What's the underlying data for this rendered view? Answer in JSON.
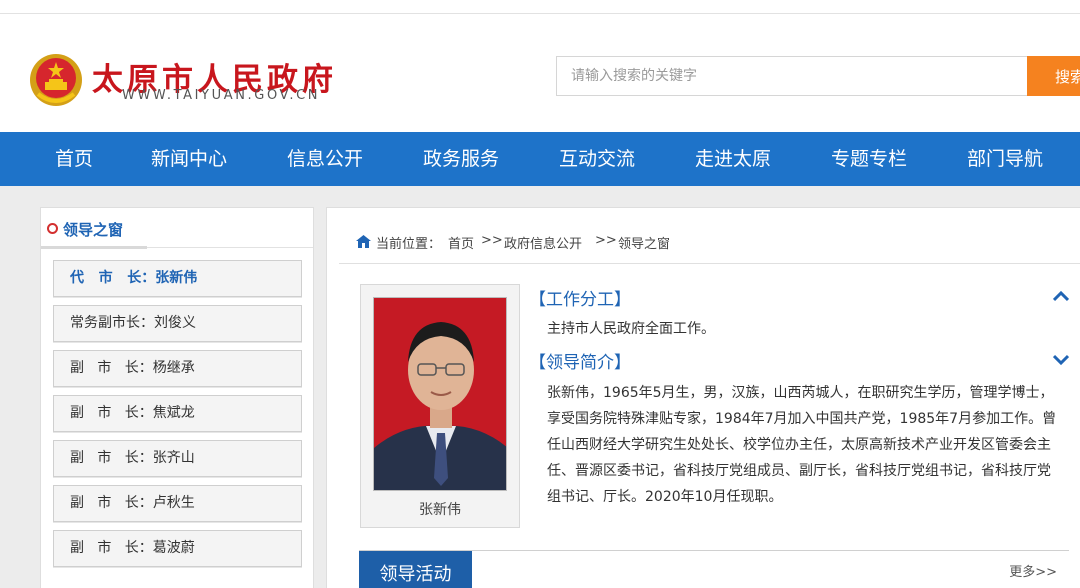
{
  "site": {
    "title": "太原市人民政府",
    "url": "WWW.TAIYUAN.GOV.CN"
  },
  "search": {
    "placeholder": "请输入搜索的关键字",
    "button": "搜索"
  },
  "nav": {
    "items": [
      "首页",
      "新闻中心",
      "信息公开",
      "政务服务",
      "互动交流",
      "走进太原",
      "专题专栏",
      "部门导航"
    ]
  },
  "sidebar": {
    "title": "领导之窗",
    "items": [
      {
        "label": "代   市   长：张新伟"
      },
      {
        "label": "常务副市长：刘俊义"
      },
      {
        "label": "副   市   长：杨继承"
      },
      {
        "label": "副   市   长：焦斌龙"
      },
      {
        "label": "副   市   长：张齐山"
      },
      {
        "label": "副   市   长：卢秋生"
      },
      {
        "label": "副   市   长：葛波蔚"
      }
    ]
  },
  "breadcrumb": {
    "prefix": "当前位置：",
    "items": [
      "首页",
      "政府信息公开",
      "领导之窗"
    ],
    "sep": ">>"
  },
  "profile": {
    "name": "张新伟",
    "duties_title": "【工作分工】",
    "duties_text": "主持市人民政府全面工作。",
    "bio_title": "【领导简介】",
    "bio_text": "张新伟，1965年5月生，男，汉族，山西芮城人，在职研究生学历，管理学博士，享受国务院特殊津贴专家，1984年7月加入中国共产党，1985年7月参加工作。曾任山西财经大学研究生处处长、校学位办主任，太原高新技术产业开发区管委会主任、晋源区委书记，省科技厅党组成员、副厅长，省科技厅党组书记，省科技厅党组书记、厅长。2020年10月任现职。"
  },
  "activity": {
    "tab": "领导活动",
    "more": "更多>>"
  },
  "colors": {
    "brand_red": "#c8161d",
    "nav_blue": "#1e73c9",
    "accent_orange": "#f5821f",
    "link_blue": "#1f64b4"
  }
}
